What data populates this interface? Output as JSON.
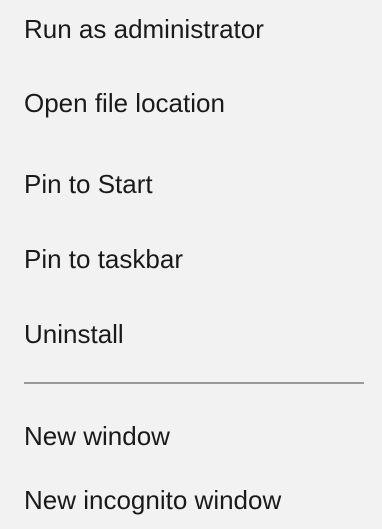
{
  "context_menu": {
    "items_top": [
      {
        "label": "Run as administrator"
      },
      {
        "label": "Open file location"
      },
      {
        "label": "Pin to Start"
      },
      {
        "label": "Pin to taskbar"
      },
      {
        "label": "Uninstall"
      }
    ],
    "items_bottom": [
      {
        "label": "New window"
      },
      {
        "label": "New incognito window"
      }
    ]
  }
}
